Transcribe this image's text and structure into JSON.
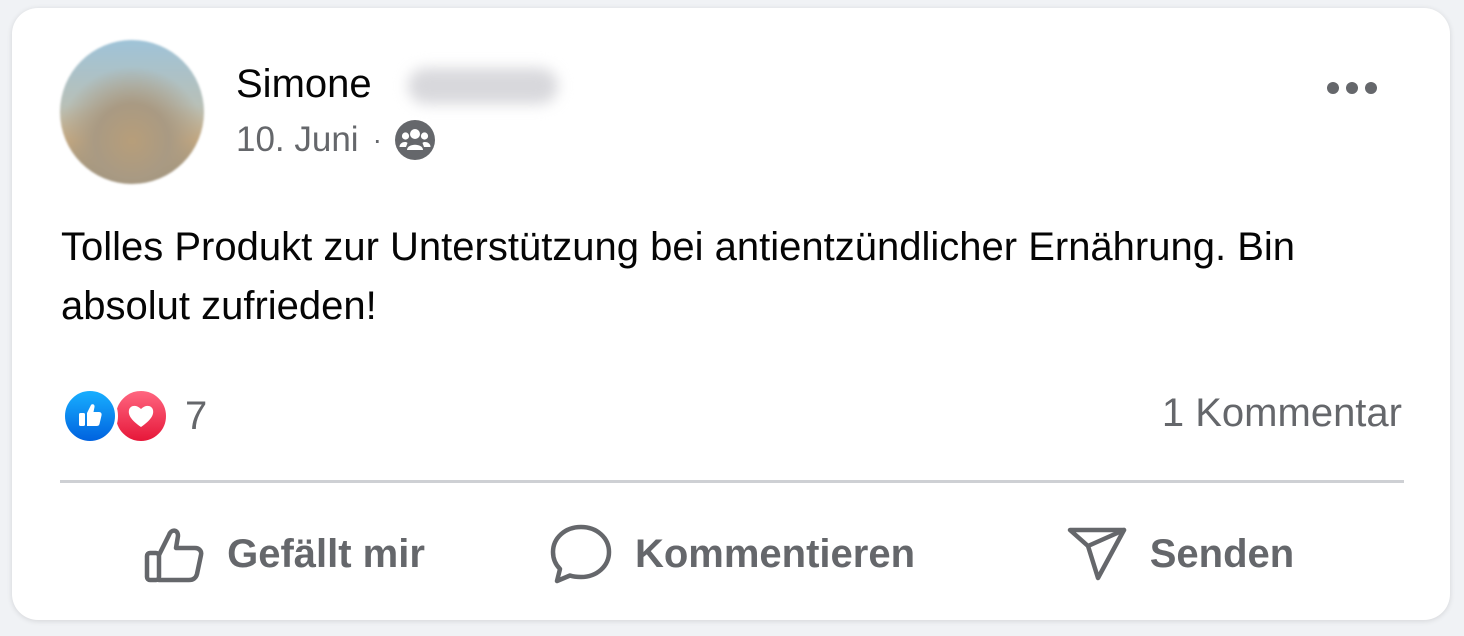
{
  "post": {
    "author_name": "Simone",
    "date": "10. Juni",
    "separator": "·",
    "audience_icon": "friends-icon",
    "more_icon": "more-horizontal-icon",
    "text": "Tolles Produkt zur Unterstützung bei antientzündlicher Ernährung. Bin absolut zufrieden!"
  },
  "engagement": {
    "reaction_icons": [
      "like-reaction-icon",
      "love-reaction-icon"
    ],
    "reaction_count": "7",
    "comment_count": "1 Kommentar"
  },
  "actions": {
    "like_label": "Gefällt mir",
    "comment_label": "Kommentieren",
    "send_label": "Senden"
  },
  "colors": {
    "like_blue": "#0866ff",
    "love_red": "#f33e58",
    "secondary_text": "#65676b",
    "primary_text": "#050505"
  }
}
